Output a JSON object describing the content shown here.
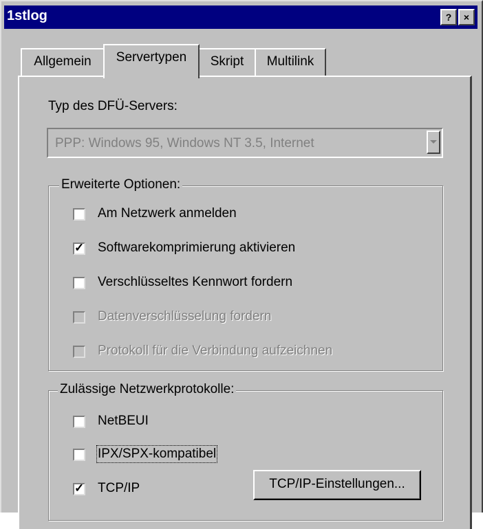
{
  "window": {
    "title": "1stlog",
    "help_button": "?",
    "close_button": "×"
  },
  "tabs": [
    {
      "label": "Allgemein",
      "active": false
    },
    {
      "label": "Servertypen",
      "active": true
    },
    {
      "label": "Skript",
      "active": false
    },
    {
      "label": "Multilink",
      "active": false
    }
  ],
  "server_type": {
    "label": "Typ des DFÜ-Servers:",
    "value": "PPP: Windows 95, Windows NT 3.5, Internet",
    "disabled": true
  },
  "advanced_options": {
    "legend": "Erweiterte Optionen:",
    "items": [
      {
        "label": "Am Netzwerk anmelden",
        "checked": false,
        "disabled": false
      },
      {
        "label": "Softwarekomprimierung aktivieren",
        "checked": true,
        "disabled": false
      },
      {
        "label": "Verschlüsseltes Kennwort fordern",
        "checked": false,
        "disabled": false
      },
      {
        "label": "Datenverschlüsselung fordern",
        "checked": false,
        "disabled": true
      },
      {
        "label": "Protokoll für die Verbindung aufzeichnen",
        "checked": false,
        "disabled": true
      }
    ]
  },
  "protocols": {
    "legend": "Zulässige Netzwerkprotokolle:",
    "items": [
      {
        "label": "NetBEUI",
        "checked": false
      },
      {
        "label": "IPX/SPX-kompatibel",
        "checked": false
      },
      {
        "label": "TCP/IP",
        "checked": true
      }
    ],
    "tcpip_settings_button": "TCP/IP-Einstellungen..."
  },
  "colors": {
    "titlebar": "#000080",
    "face": "#c0c0c0",
    "disabled_text": "#808080"
  }
}
